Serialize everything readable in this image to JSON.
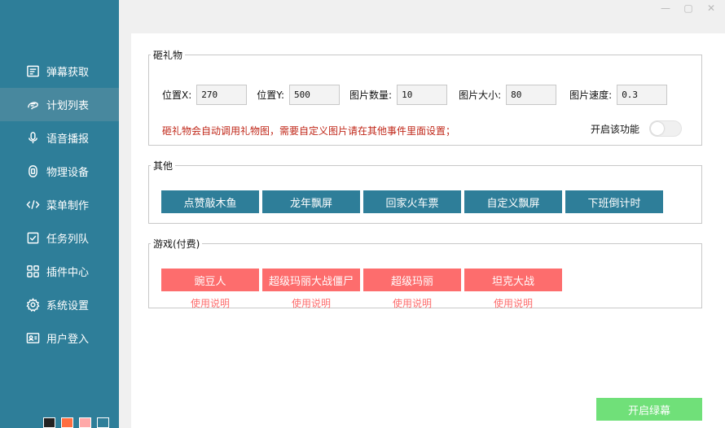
{
  "corner_mark": "`",
  "sidebar": {
    "items": [
      {
        "label": "弹幕获取",
        "icon": "danmaku-icon"
      },
      {
        "label": "计划列表",
        "icon": "plan-list-icon",
        "active": true
      },
      {
        "label": "语音播报",
        "icon": "microphone-icon"
      },
      {
        "label": "物理设备",
        "icon": "device-icon"
      },
      {
        "label": "菜单制作",
        "icon": "code-icon"
      },
      {
        "label": "任务列队",
        "icon": "task-queue-icon"
      },
      {
        "label": "插件中心",
        "icon": "plugin-grid-icon"
      },
      {
        "label": "系统设置",
        "icon": "gear-icon"
      },
      {
        "label": "用户登入",
        "icon": "user-card-icon"
      }
    ],
    "theme_swatches": [
      "#222222",
      "#ff6e40",
      "#ffa9a9",
      "#2e7e99"
    ]
  },
  "window_controls": {
    "minimize": "—",
    "maximize": "▢",
    "close": "✕"
  },
  "gift": {
    "legend": "砸礼物",
    "fields": [
      {
        "label": "位置X:",
        "value": "270"
      },
      {
        "label": "位置Y:",
        "value": "500"
      },
      {
        "label": "图片数量:",
        "value": "10"
      },
      {
        "label": "图片大小:",
        "value": "80"
      },
      {
        "label": "图片速度:",
        "value": "0.3"
      }
    ],
    "warning": "砸礼物会自动调用礼物图，需要自定义图片请在其他事件里面设置；",
    "toggle_label": "开启该功能",
    "toggle_on": false
  },
  "other": {
    "legend": "其他",
    "buttons": [
      "点赞敲木鱼",
      "龙年飘屏",
      "回家火车票",
      "自定义飘屏",
      "下班倒计时"
    ]
  },
  "games": {
    "legend": "游戏(付费)",
    "buttons": [
      "豌豆人",
      "超级玛丽大战僵尸",
      "超级玛丽",
      "坦克大战"
    ],
    "help": [
      "使用说明",
      "使用说明",
      "使用说明",
      "使用说明"
    ]
  },
  "start_button": "开启绿幕",
  "colors": {
    "accent": "#2e7e99",
    "danger": "#fd6d6d",
    "success": "#70e079",
    "warning_text": "#c0281a"
  }
}
